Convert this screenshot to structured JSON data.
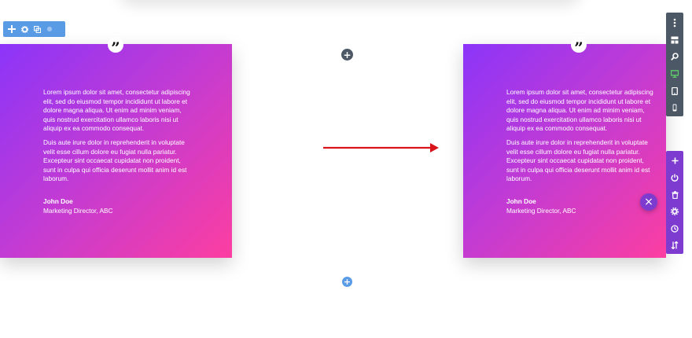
{
  "module_toolbar": {
    "icons": [
      "move-icon",
      "gear-icon",
      "duplicate-icon",
      "more-icon"
    ]
  },
  "testimonial_before": {
    "quote_glyph": "”",
    "paragraph1": "Lorem ipsum dolor sit amet, consectetur adipiscing elit, sed do eiusmod tempor incididunt ut labore et dolore magna aliqua. Ut enim ad minim veniam, quis nostrud exercitation ullamco laboris nisi ut aliquip ex ea commodo consequat.",
    "paragraph2": "Duis aute irure dolor in reprehenderit in voluptate velit esse cillum dolore eu fugiat nulla pariatur. Excepteur sint occaecat cupidatat non proident, sunt in culpa qui officia deserunt mollit anim id est laborum.",
    "author": "John Doe",
    "role": "Marketing Director, ABC"
  },
  "testimonial_after": {
    "quote_glyph": "”",
    "paragraph1": "Lorem ipsum dolor sit amet, consectetur adipiscing elit, sed do eiusmod tempor incididunt ut labore et dolore magna aliqua. Ut enim ad minim veniam, quis nostrud exercitation ullamco laboris nisi ut aliquip ex ea commodo consequat.",
    "paragraph2": "Duis aute irure dolor in reprehenderit in voluptate velit esse cillum dolore eu fugiat nulla pariatur. Excepteur sint occaecat cupidatat non proident, sunt in culpa qui officia deserunt mollit anim id est laborum.",
    "author": "John Doe",
    "role": "Marketing Director, ABC"
  },
  "colors": {
    "gradient_start": "#8b35f9",
    "gradient_end": "#fc3ea1",
    "toolbar_blue": "#5a9be6",
    "sidebar_dark": "#4c5866",
    "sidebar_purple": "#7e3bd0",
    "arrow_red": "#d9151b"
  },
  "glyphs": {
    "plus": "+",
    "close": "×"
  },
  "right_sidebar_top": [
    "more-vertical-icon",
    "layout-icon",
    "zoom-icon",
    "desktop-icon",
    "tablet-icon",
    "phone-icon"
  ],
  "right_sidebar_bottom": [
    "add-icon",
    "power-icon",
    "trash-icon",
    "gear-icon",
    "history-icon",
    "sort-icon"
  ]
}
